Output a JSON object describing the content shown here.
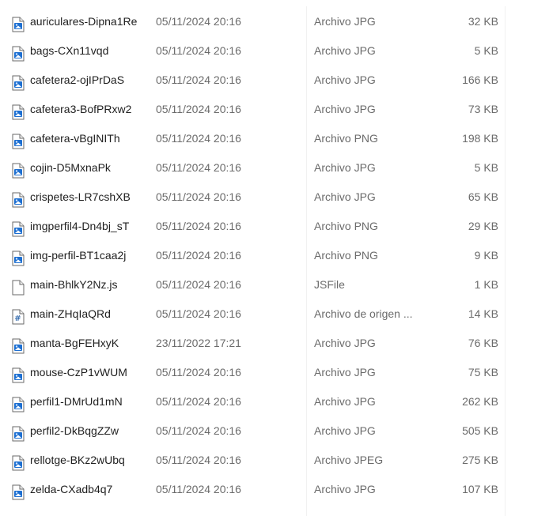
{
  "files": [
    {
      "name": "auriculares-Dipna1Re",
      "date": "05/11/2024 20:16",
      "type": "Archivo JPG",
      "size": "32 KB",
      "icon": "image-file-icon"
    },
    {
      "name": "bags-CXn11vqd",
      "date": "05/11/2024 20:16",
      "type": "Archivo JPG",
      "size": "5 KB",
      "icon": "image-file-icon"
    },
    {
      "name": "cafetera2-ojIPrDaS",
      "date": "05/11/2024 20:16",
      "type": "Archivo JPG",
      "size": "166 KB",
      "icon": "image-file-icon"
    },
    {
      "name": "cafetera3-BofPRxw2",
      "date": "05/11/2024 20:16",
      "type": "Archivo JPG",
      "size": "73 KB",
      "icon": "image-file-icon"
    },
    {
      "name": "cafetera-vBgINITh",
      "date": "05/11/2024 20:16",
      "type": "Archivo PNG",
      "size": "198 KB",
      "icon": "image-file-icon"
    },
    {
      "name": "cojin-D5MxnaPk",
      "date": "05/11/2024 20:16",
      "type": "Archivo JPG",
      "size": "5 KB",
      "icon": "image-file-icon"
    },
    {
      "name": "crispetes-LR7cshXB",
      "date": "05/11/2024 20:16",
      "type": "Archivo JPG",
      "size": "65 KB",
      "icon": "image-file-icon"
    },
    {
      "name": "imgperfil4-Dn4bj_sT",
      "date": "05/11/2024 20:16",
      "type": "Archivo PNG",
      "size": "29 KB",
      "icon": "image-file-icon"
    },
    {
      "name": "img-perfil-BT1caa2j",
      "date": "05/11/2024 20:16",
      "type": "Archivo PNG",
      "size": "9 KB",
      "icon": "image-file-icon"
    },
    {
      "name": "main-BhlkY2Nz.js",
      "date": "05/11/2024 20:16",
      "type": "JSFile",
      "size": "1 KB",
      "icon": "blank-file-icon"
    },
    {
      "name": "main-ZHqIaQRd",
      "date": "05/11/2024 20:16",
      "type": "Archivo de origen ...",
      "size": "14 KB",
      "icon": "source-file-icon"
    },
    {
      "name": "manta-BgFEHxyK",
      "date": "23/11/2022 17:21",
      "type": "Archivo JPG",
      "size": "76 KB",
      "icon": "image-file-icon"
    },
    {
      "name": "mouse-CzP1vWUM",
      "date": "05/11/2024 20:16",
      "type": "Archivo JPG",
      "size": "75 KB",
      "icon": "image-file-icon"
    },
    {
      "name": "perfil1-DMrUd1mN",
      "date": "05/11/2024 20:16",
      "type": "Archivo JPG",
      "size": "262 KB",
      "icon": "image-file-icon"
    },
    {
      "name": "perfil2-DkBqgZZw",
      "date": "05/11/2024 20:16",
      "type": "Archivo JPG",
      "size": "505 KB",
      "icon": "image-file-icon"
    },
    {
      "name": "rellotge-BKz2wUbq",
      "date": "05/11/2024 20:16",
      "type": "Archivo JPEG",
      "size": "275 KB",
      "icon": "image-file-icon"
    },
    {
      "name": "zelda-CXadb4q7",
      "date": "05/11/2024 20:16",
      "type": "Archivo JPG",
      "size": "107 KB",
      "icon": "image-file-icon"
    }
  ],
  "colors": {
    "icon_blue": "#1d6fd1",
    "icon_border": "#6a6a6a",
    "secondary_text": "#6b6b6b"
  }
}
